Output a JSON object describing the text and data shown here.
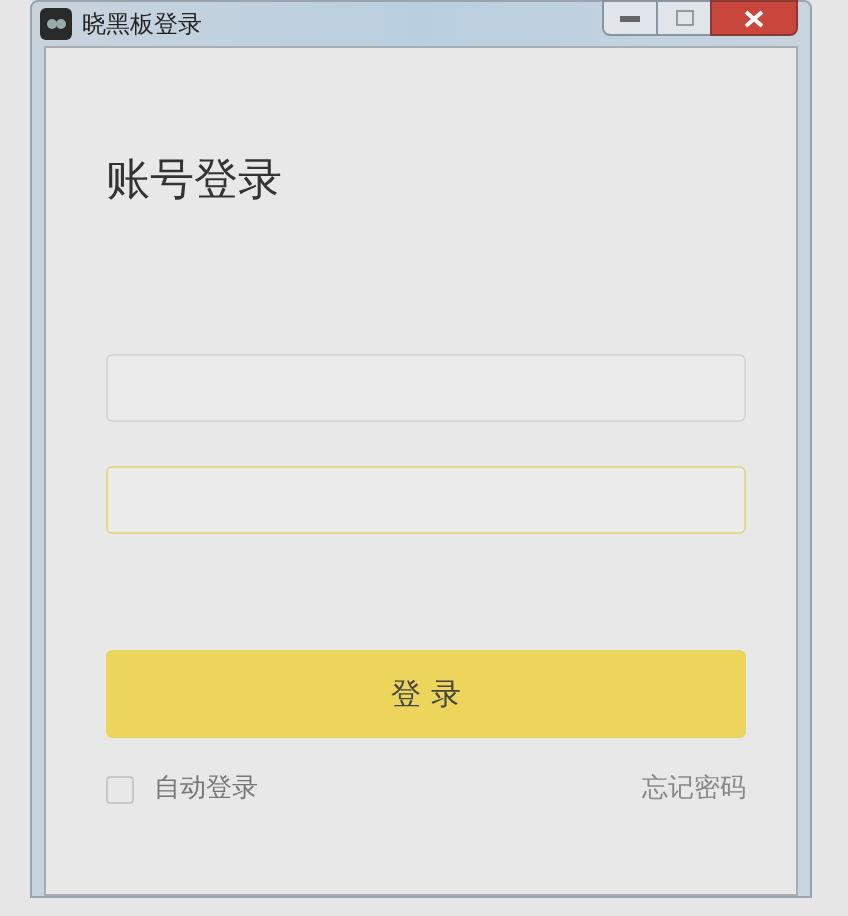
{
  "window": {
    "title": "晓黑板登录"
  },
  "heading": "账号登录",
  "fields": [
    {
      "focused": false
    },
    {
      "focused": true
    }
  ],
  "login_button": "登 录",
  "auto_login": {
    "label": "自动登录",
    "checked": false
  },
  "forgot_password": "忘记密码"
}
